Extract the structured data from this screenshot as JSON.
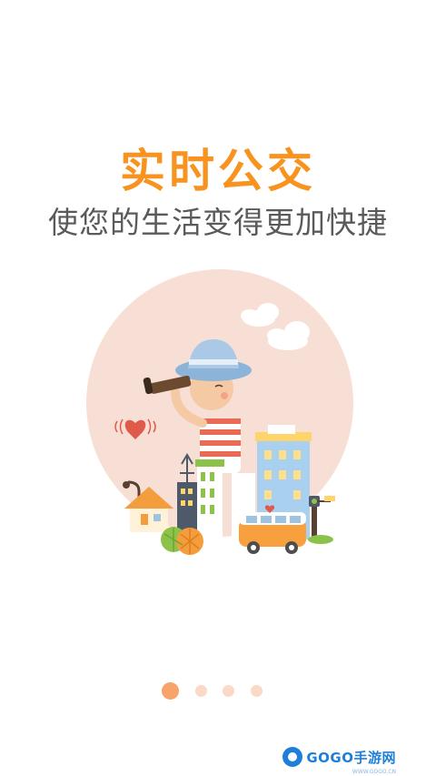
{
  "hero": {
    "title": "实时公交",
    "subtitle": "使您的生活变得更加快捷"
  },
  "illustration": {
    "icon": "city-boy-telescope-illustration",
    "bus_label": "bus"
  },
  "pager": {
    "total": 4,
    "active_index": 0,
    "active_color": "#f7a36b",
    "inactive_color": "#fbd9c6"
  },
  "watermark": {
    "brand": "GOGO手游网",
    "url": "WWW.GOGO.CN"
  },
  "colors": {
    "accent": "#f7931e",
    "text": "#5a5a5a",
    "circle_bg": "#f7dfd6"
  }
}
